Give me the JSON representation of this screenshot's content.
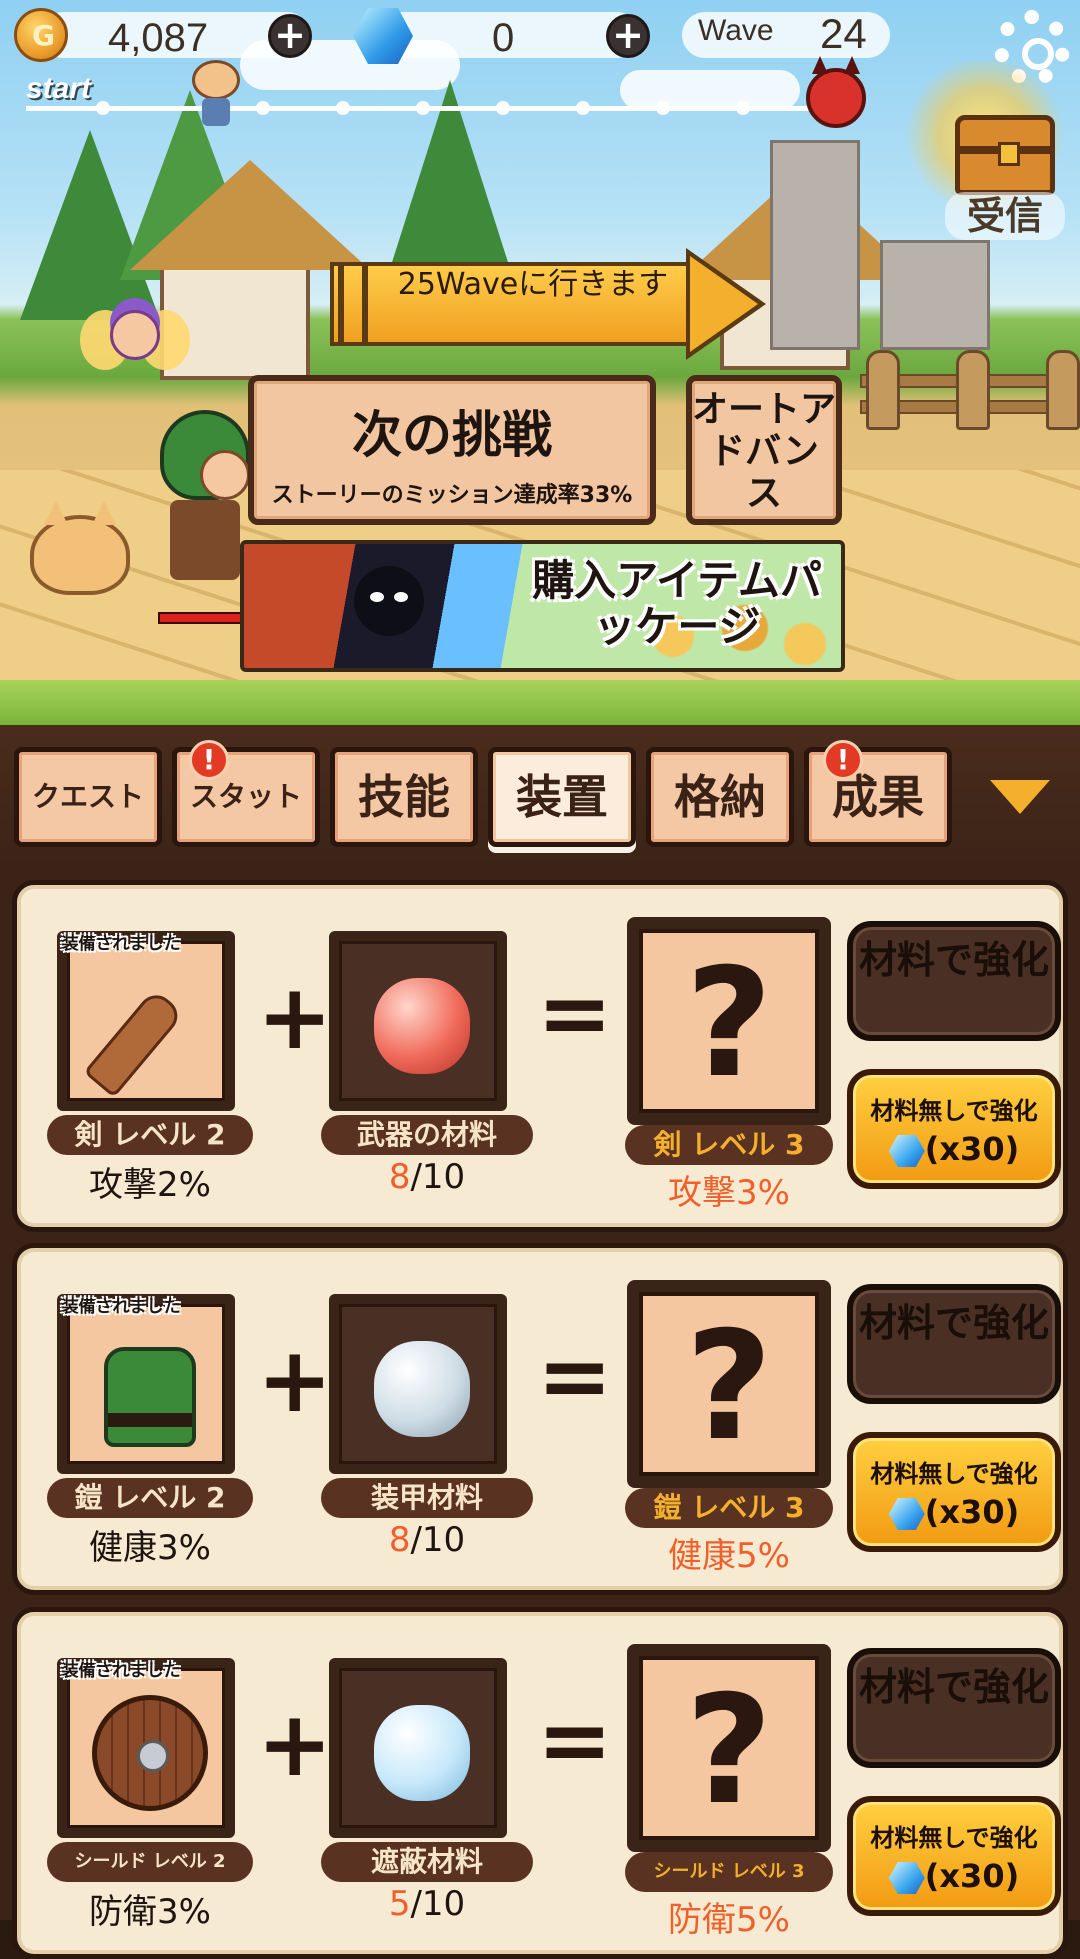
{
  "hud": {
    "gold": "4,087",
    "gems": "0",
    "wave_label": "Wave",
    "wave_number": "24",
    "start_label": "start"
  },
  "chest": {
    "label": "受信"
  },
  "wave_button": {
    "label": "25Waveに行きます"
  },
  "next_challenge": {
    "title": "次の挑戦",
    "subtitle": "ストーリーのミッション達成率33%"
  },
  "auto_advance": {
    "label": "オートアドバンス"
  },
  "package_banner": {
    "label": "購入アイテムパッケージ"
  },
  "tabs": [
    {
      "label": "クエスト",
      "badge": ""
    },
    {
      "label": "スタット",
      "badge": "!"
    },
    {
      "label": "技能",
      "badge": ""
    },
    {
      "label": "装置",
      "badge": "",
      "active": true
    },
    {
      "label": "格納",
      "badge": ""
    },
    {
      "label": "成果",
      "badge": "!"
    }
  ],
  "equipment": [
    {
      "equipped_label": "装備されました",
      "current_name": "剣 レベル 2",
      "current_stat": "攻撃2%",
      "material_name": "武器の材料",
      "material_have": "8",
      "material_need": "/10",
      "next_name": "剣 レベル 3",
      "next_stat": "攻撃3%",
      "upgrade_material_label": "材料で強化",
      "upgrade_free_label": "材料無しで強化",
      "upgrade_cost": "(x30)"
    },
    {
      "equipped_label": "装備されました",
      "current_name": "鎧 レベル 2",
      "current_stat": "健康3%",
      "material_name": "装甲材料",
      "material_have": "8",
      "material_need": "/10",
      "next_name": "鎧 レベル 3",
      "next_stat": "健康5%",
      "upgrade_material_label": "材料で強化",
      "upgrade_free_label": "材料無しで強化",
      "upgrade_cost": "(x30)"
    },
    {
      "equipped_label": "装備されました",
      "current_name": "シールド レベル 2",
      "current_stat": "防衛3%",
      "material_name": "遮蔽材料",
      "material_have": "5",
      "material_need": "/10",
      "next_name": "シールド レベル 3",
      "next_stat": "防衛5%",
      "upgrade_material_label": "材料で強化",
      "upgrade_free_label": "材料無しで強化",
      "upgrade_cost": "(x30)"
    }
  ],
  "colors": {
    "accent_orange": "#f4b02c",
    "panel_brown": "#3b2417",
    "tab_face": "#f4c8a4",
    "highlight_red": "#f0602a"
  }
}
